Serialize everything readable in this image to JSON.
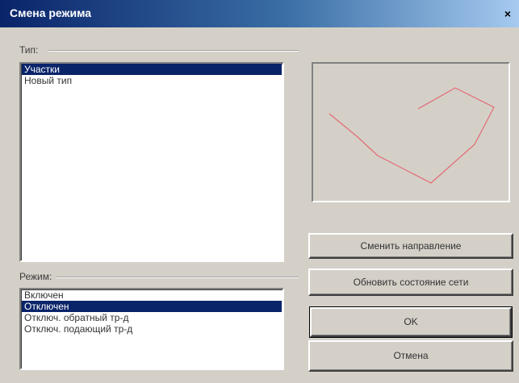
{
  "dialog": {
    "title": "Смена режима",
    "close_label": "×"
  },
  "type_group": {
    "label": "Тип:",
    "items": [
      {
        "label": "Участки",
        "selected": true
      },
      {
        "label": "Новый тип",
        "selected": false
      }
    ]
  },
  "mode_group": {
    "label": "Режим:",
    "items": [
      {
        "label": "Включен",
        "selected": false
      },
      {
        "label": "Отключен",
        "selected": true
      },
      {
        "label": "Отключ. обратный тр-д",
        "selected": false
      },
      {
        "label": "Отключ. подающий тр-д",
        "selected": false
      }
    ]
  },
  "buttons": {
    "change_direction": "Сменить направление",
    "update_network": "Обновить состояние сети",
    "ok": "OK",
    "cancel": "Отмена"
  },
  "colors": {
    "selection": "#0a246a",
    "preview_line": "#e8485a"
  }
}
